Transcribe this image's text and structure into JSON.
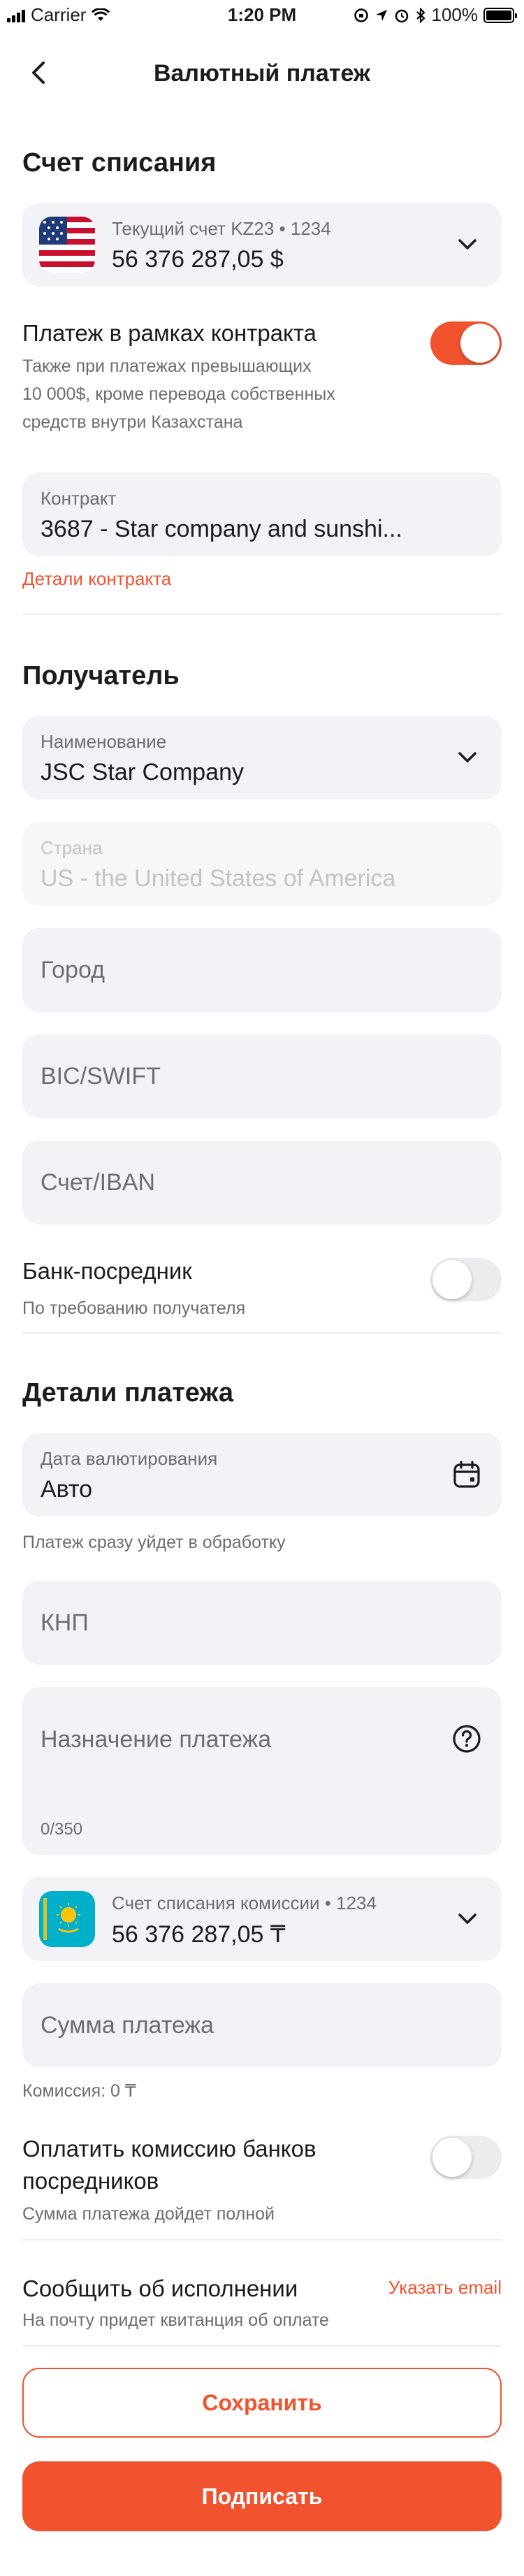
{
  "status_bar": {
    "carrier": "Carrier",
    "time": "1:20 PM",
    "battery": "100%"
  },
  "nav": {
    "title": "Валютный платеж"
  },
  "debit": {
    "heading": "Счет списания",
    "account_label": "Текущий счет KZ23 • 1234",
    "account_balance": "56 376 287,05 $"
  },
  "contract_payment": {
    "title": "Платеж в рамках контракта",
    "subtitle_line1": "Также при платежах превышающих",
    "subtitle_line2": "10 000$, кроме перевода собственных",
    "subtitle_line3": "средств внутри Казахстана",
    "enabled": true
  },
  "contract": {
    "label": "Контракт",
    "value": "3687 - Star company and sunshi...",
    "details_link": "Детали контракта"
  },
  "recipient": {
    "heading": "Получатель",
    "name_label": "Наименование",
    "name_value": "JSC Star Company",
    "country_label": "Страна",
    "country_value": "US - the United States of America",
    "city_placeholder": "Город",
    "bic_placeholder": "BIC/SWIFT",
    "iban_placeholder": "Счет/IBAN",
    "intermediary_title": "Банк-посредник",
    "intermediary_subtitle": "По требованию получателя",
    "intermediary_enabled": false
  },
  "payment_details": {
    "heading": "Детали платежа",
    "valuation_label": "Дата валютирования",
    "valuation_value": "Авто",
    "valuation_hint": "Платеж сразу уйдет в обработку",
    "knp_placeholder": "КНП",
    "purpose_placeholder": "Назначение платежа",
    "purpose_counter": "0/350",
    "commission_account_label": "Счет списания комиссии • 1234",
    "commission_account_balance": "56 376 287,05 ₸",
    "amount_placeholder": "Сумма платежа",
    "commission_text": "Комиссия: 0 ₸",
    "pay_intermediary_title_line1": "Оплатить комиссию банков",
    "pay_intermediary_title_line2": "посредников",
    "pay_intermediary_subtitle": "Сумма платежа дойдет полной",
    "pay_intermediary_enabled": false,
    "notify_title": "Сообщить об исполнении",
    "notify_link": "Указать email",
    "notify_subtitle": "На почту придет квитанция об оплате"
  },
  "actions": {
    "save": "Сохранить",
    "sign": "Подписать"
  },
  "colors": {
    "accent": "#f0532e",
    "field_bg": "#f2f2f7",
    "muted": "#6d6d72"
  }
}
